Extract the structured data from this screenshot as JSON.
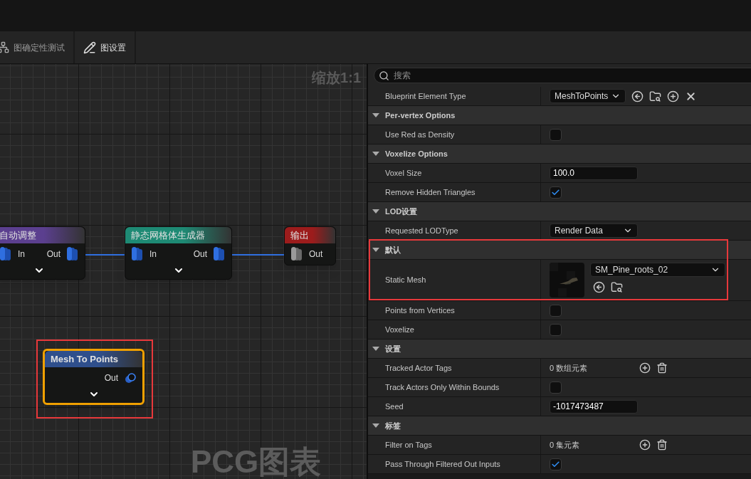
{
  "toolbar": {
    "buttons": [
      {
        "label": "图确定性测试",
        "kind": "determinism"
      },
      {
        "label": "图设置",
        "kind": "settings"
      }
    ]
  },
  "graph": {
    "zoom_label": "缩放1:1",
    "title_watermark": "PCG图表",
    "nodes": [
      {
        "title": "自动调整",
        "color": "#5b3f8f",
        "selected": false,
        "inputs": [
          {
            "label": "In",
            "kind": "spatial"
          }
        ],
        "outputs": [
          {
            "label": "Out",
            "kind": "spatial"
          }
        ]
      },
      {
        "title": "静态网格体生成器",
        "color": "#1e8a74",
        "selected": false,
        "inputs": [
          {
            "label": "In",
            "kind": "spatial"
          }
        ],
        "outputs": [
          {
            "label": "Out",
            "kind": "spatial"
          }
        ]
      },
      {
        "title": "输出",
        "color": "#9c1c1c",
        "selected": false,
        "inputs": [
          {
            "label": "Out",
            "kind": "any"
          }
        ]
      },
      {
        "title": "Mesh To Points",
        "color": "#2f4f8c",
        "selected": true,
        "highlighted": true,
        "outputs": [
          {
            "label": "Out",
            "kind": "point"
          }
        ]
      }
    ]
  },
  "details": {
    "search": {
      "placeholder": "搜索"
    },
    "top_rows": [
      {
        "label": "Blueprint Element Type",
        "kind": "class_picker",
        "value": "MeshToPoints"
      }
    ],
    "sections": [
      {
        "title": "Per-vertex Options",
        "expanded": true,
        "rows": [
          {
            "label": "Use Red as Density",
            "kind": "checkbox",
            "checked": false
          }
        ]
      },
      {
        "title": "Voxelize Options",
        "expanded": true,
        "rows": [
          {
            "label": "Voxel Size",
            "kind": "number",
            "value": "100.0"
          },
          {
            "label": "Remove Hidden Triangles",
            "kind": "checkbox",
            "checked": true
          }
        ]
      },
      {
        "title": "LOD设置",
        "expanded": true,
        "rows": [
          {
            "label": "Requested LODType",
            "kind": "dropdown",
            "value": "Render Data"
          }
        ]
      },
      {
        "title": "默认",
        "expanded": true,
        "highlighted": true,
        "rows": [
          {
            "label": "Static Mesh",
            "kind": "asset",
            "value": "SM_Pine_roots_02"
          }
        ]
      },
      {
        "rows": [
          {
            "label": "Points from Vertices",
            "kind": "checkbox",
            "checked": false
          },
          {
            "label": "Voxelize",
            "kind": "checkbox",
            "checked": false
          }
        ]
      },
      {
        "title": "设置",
        "expanded": true,
        "rows": [
          {
            "label": "Tracked Actor Tags",
            "kind": "array",
            "value": "0 数组元素"
          },
          {
            "label": "Track Actors Only Within Bounds",
            "kind": "checkbox",
            "checked": false
          },
          {
            "label": "Seed",
            "kind": "number",
            "value": "-1017473487"
          }
        ]
      },
      {
        "title": "标签",
        "expanded": true,
        "rows": [
          {
            "label": "Filter on Tags",
            "kind": "array",
            "value": "0 集元素"
          },
          {
            "label": "Pass Through Filtered Out Inputs",
            "kind": "checkbox",
            "checked": true
          }
        ]
      }
    ]
  }
}
